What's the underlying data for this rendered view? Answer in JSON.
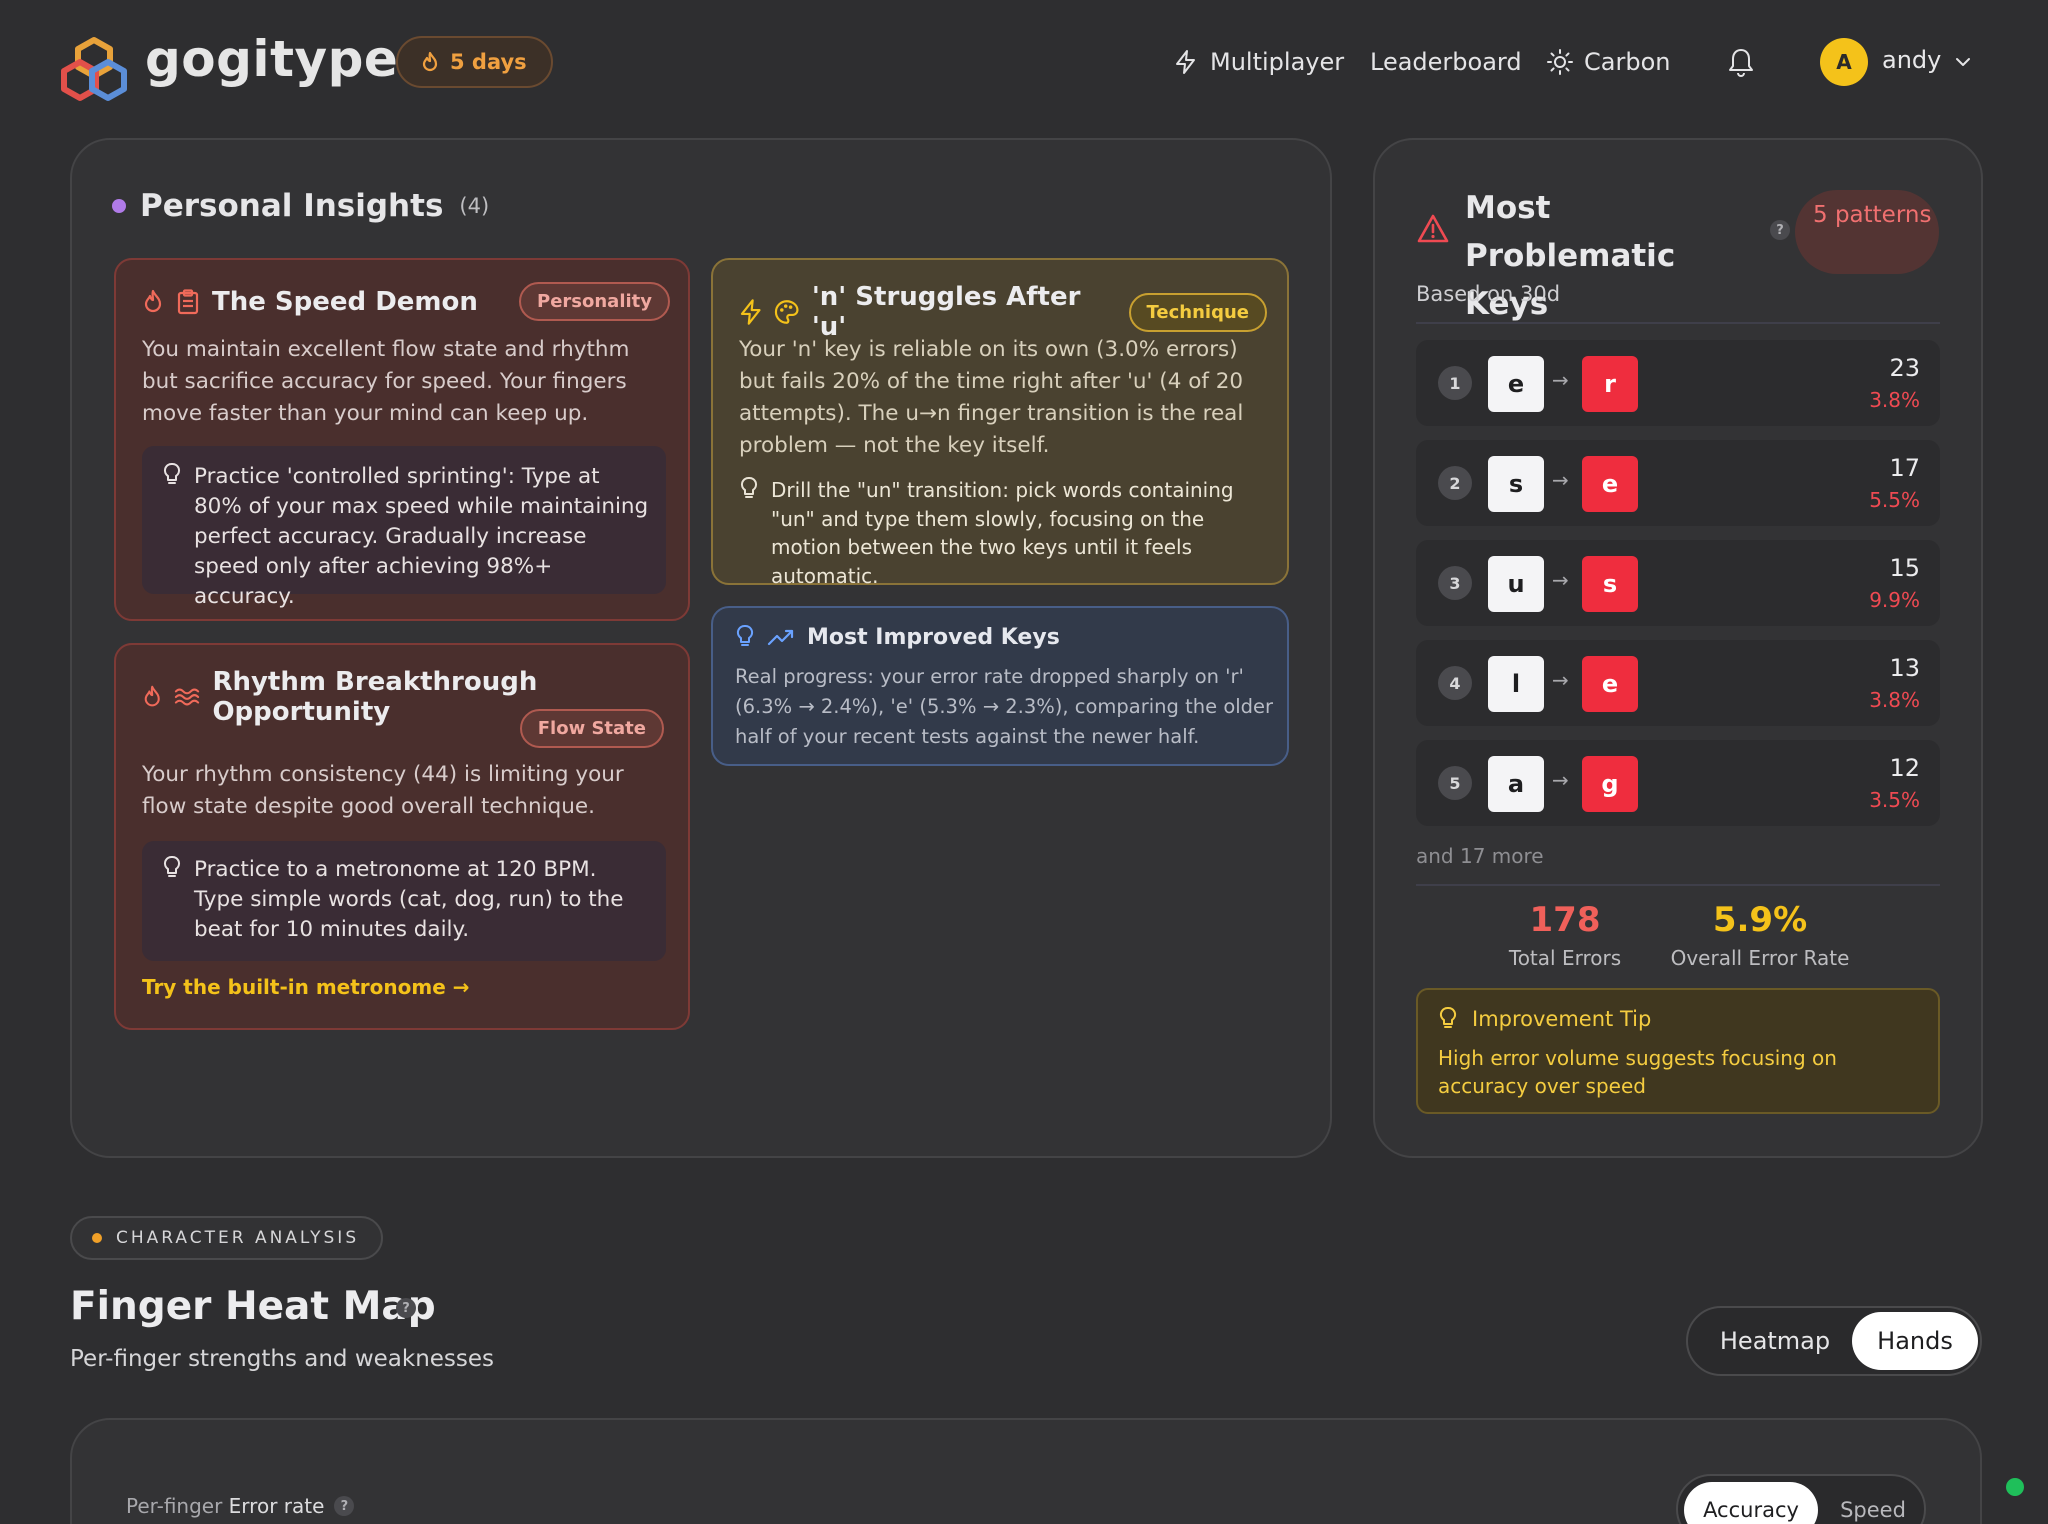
{
  "brand": {
    "name": "gogitype"
  },
  "streak": {
    "label": "5 days",
    "icon": "flame-icon"
  },
  "nav": {
    "multiplayer": "Multiplayer",
    "leaderboard": "Leaderboard",
    "carbon": "Carbon"
  },
  "user": {
    "initial": "A",
    "name": "andy"
  },
  "insights": {
    "title": "Personal Insights",
    "count": "(4)",
    "speed_demon": {
      "title": "The Speed Demon",
      "badge": "Personality",
      "body": "You maintain excellent flow state and rhythm but sacrifice accuracy for speed. Your fingers move faster than your mind can keep up.",
      "tip": "Practice 'controlled sprinting': Type at 80% of your max speed while maintaining perfect accuracy. Gradually increase speed only after achieving 98%+ accuracy."
    },
    "rhythm": {
      "title": "Rhythm Breakthrough Opportunity",
      "badge": "Flow State",
      "body": "Your rhythm consistency (44) is limiting your flow state despite good overall technique.",
      "tip": "Practice to a metronome at 120 BPM. Type simple words (cat, dog, run) to the beat for 10 minutes daily.",
      "link": "Try the built-in metronome →"
    },
    "struggle": {
      "title": "'n' Struggles After 'u'",
      "badge": "Technique",
      "body": "Your 'n' key is reliable on its own (3.0% errors) but fails 20% of the time right after 'u' (4 of 20 attempts). The u→n finger transition is the real problem — not the key itself.",
      "tip": "Drill the \"un\" transition: pick words containing \"un\" and type them slowly, focusing on the motion between the two keys until it feels automatic."
    },
    "improved": {
      "title": "Most Improved Keys",
      "body": "Real progress: your error rate dropped sharply on 'r' (6.3% → 2.4%), 'e' (5.3% → 2.3%), comparing the older half of your recent tests against the newer half."
    }
  },
  "problem_keys": {
    "title": "Most Problematic Keys",
    "help": "?",
    "badge": "5 patterns",
    "based_on": "Based on 30d",
    "arrow": "→",
    "rows": [
      {
        "rank": "1",
        "from": "e",
        "to": "r",
        "count": "23",
        "pct": "3.8%"
      },
      {
        "rank": "2",
        "from": "s",
        "to": "e",
        "count": "17",
        "pct": "5.5%"
      },
      {
        "rank": "3",
        "from": "u",
        "to": "s",
        "count": "15",
        "pct": "9.9%"
      },
      {
        "rank": "4",
        "from": "l",
        "to": "e",
        "count": "13",
        "pct": "3.8%"
      },
      {
        "rank": "5",
        "from": "a",
        "to": "g",
        "count": "12",
        "pct": "3.5%"
      }
    ],
    "more": "and 17 more",
    "total_errors": {
      "value": "178",
      "label": "Total Errors",
      "color": "#f0605a"
    },
    "error_rate": {
      "value": "5.9%",
      "label": "Overall Error Rate",
      "color": "#f4c21a"
    },
    "tip": {
      "title": "Improvement Tip",
      "body": "High error volume suggests focusing on accuracy over speed"
    }
  },
  "character_analysis": {
    "section_label": "CHARACTER ANALYSIS",
    "title": "Finger Heat Map",
    "help": "?",
    "subtitle": "Per-finger strengths and weaknesses",
    "view_options": [
      "Heatmap",
      "Hands"
    ],
    "selected_view": "Hands",
    "metric_label_prefix": "Per-finger",
    "metric_label": "Error rate",
    "metric_options": [
      "Accuracy",
      "Speed"
    ],
    "selected_metric": "Accuracy"
  },
  "colors": {
    "accent_red": "#ef2d3e",
    "accent_amber": "#f4cc40",
    "accent_purple": "#b07be8",
    "online": "#1fbf5a"
  }
}
